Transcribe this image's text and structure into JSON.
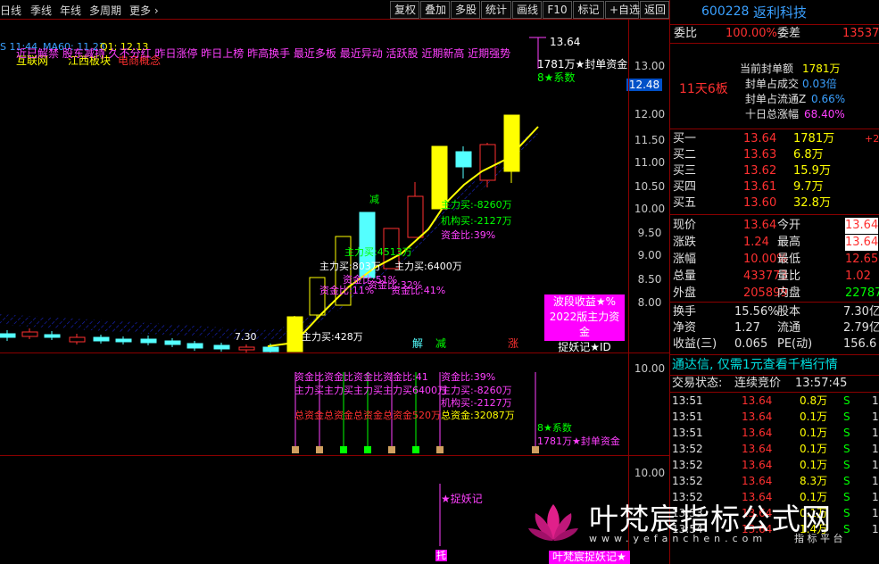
{
  "toolbar": {
    "period_day": "日线",
    "period_season": "季线",
    "period_year": "年线",
    "multi_period": "多周期",
    "more": "更多",
    "buttons": [
      "复权",
      "叠加",
      "多股",
      "统计",
      "画线",
      "F10",
      "标记",
      "+自选",
      "返回"
    ]
  },
  "stock": {
    "code": "600228",
    "name": "返利科技"
  },
  "quote_bar": {
    "time": "S 11:44",
    "ma_label": "MA60: 11.23",
    "q1": "Q1: 12.13"
  },
  "concepts": [
    "互联网",
    "江西板块",
    "电商概念"
  ],
  "tags_line": "近已解禁 股东减持 久不分红 昨日涨停 昨日上榜 昨高换手 最近多板 最近异动 活跃股 近期新高 近期强势",
  "price_axis": [
    "13.00",
    "12.50",
    "12.00",
    "11.50",
    "11.00",
    "10.50",
    "10.00",
    "9.50",
    "9.00",
    "8.50",
    "8.00"
  ],
  "price_axis_current": "12.48",
  "vol_axis": "10.00",
  "ind3_axis": "10.00",
  "chart_labels": {
    "high_price": "13.64",
    "low_price": "7.30",
    "seal_funds": "1781万★封单资金",
    "coef": "8★系数",
    "reduce1": "减",
    "reduce2": "减",
    "explain": "解",
    "up": "涨",
    "main_buy_1": "主力买:428万",
    "main_buy_2": "主力买:803万",
    "main_buy_3": "主力买:6400万",
    "main_buy_4": "主力买:-8260万",
    "inst_buy_4": "机构买:-2127万",
    "fund_ratio_4": "资金比:39%",
    "main_buy_5": "主力买:4513万",
    "fund_ratio_5": "资金比:41%",
    "fund_ratio_6": "资金比:11%",
    "fund_ratio_7": "资金比:51%",
    "fund_ratio_8": "资金比:32%",
    "wave_box_1": "波段收益★%",
    "wave_box_2": "2022版主力资金",
    "wave_box_3": "捉妖记★ID"
  },
  "mid_labels": {
    "fund_ratio": "资金比:39%",
    "main_buy": "主力买:-8260万",
    "inst_buy": "机构买:-2127万",
    "total_funds": "总资金:32087万",
    "coef": "8★系数",
    "seal": "1781万★封单资金",
    "overlap_1": "资金比资金比资金比资金比:41",
    "overlap_2": "主力买主力买主力买主力买6400万",
    "overlap_3": "总资金总资金总资金总资金520万"
  },
  "bottom_labels": {
    "catch": "★捉妖记",
    "tuo": "托"
  },
  "panel": {
    "ratio_label": "委比",
    "ratio_value": "100.00%",
    "diff_label": "委差",
    "diff_value": "13537",
    "board_title": "11天6板",
    "seal_amount_label": "当前封单额",
    "seal_amount_value": "1781万",
    "seal_turn_label": "封单占成交",
    "seal_turn_value": "0.03倍",
    "seal_float_label": "封单占流通Z",
    "seal_float_value": "0.66%",
    "ten_day_label": "十日总涨幅",
    "ten_day_value": "68.40%",
    "bids": [
      {
        "label": "买一",
        "price": "13.64",
        "vol": "1781万",
        "chg": "+2"
      },
      {
        "label": "买二",
        "price": "13.63",
        "vol": "6.8万",
        "chg": ""
      },
      {
        "label": "买三",
        "price": "13.62",
        "vol": "15.9万",
        "chg": ""
      },
      {
        "label": "买四",
        "price": "13.61",
        "vol": "9.7万",
        "chg": ""
      },
      {
        "label": "买五",
        "price": "13.60",
        "vol": "32.8万",
        "chg": ""
      }
    ],
    "stats": [
      {
        "l1": "现价",
        "v1": "13.64",
        "l2": "今开",
        "v2": "13.64"
      },
      {
        "l1": "涨跌",
        "v1": "1.24",
        "l2": "最高",
        "v2": "13.64"
      },
      {
        "l1": "涨幅",
        "v1": "10.00%",
        "l2": "最低",
        "v2": "12.65"
      },
      {
        "l1": "总量",
        "v1": "433773",
        "l2": "量比",
        "v2": "1.02"
      },
      {
        "l1": "外盘",
        "v1": "205899",
        "l2": "内盘",
        "v2": "227874"
      }
    ],
    "stats2": [
      {
        "l1": "换手",
        "v1": "15.56%",
        "l2": "股本",
        "v2": "7.30亿"
      },
      {
        "l1": "净资",
        "v1": "1.27",
        "l2": "流通",
        "v2": "2.79亿"
      },
      {
        "l1": "收益(三)",
        "v1": "0.065",
        "l2": "PE(动)",
        "v2": "156.6"
      }
    ],
    "promo": "通达信, 仅需1元查看千档行情",
    "trade_state_label": "交易状态:",
    "trade_state_value": "连续竞价",
    "trade_time": "13:57:45",
    "ticks": [
      {
        "t": "13:51",
        "p": "13.64",
        "v": "0.8万",
        "s": "S",
        "n": "1"
      },
      {
        "t": "13:51",
        "p": "13.64",
        "v": "0.1万",
        "s": "S",
        "n": "1"
      },
      {
        "t": "13:51",
        "p": "13.64",
        "v": "0.1万",
        "s": "S",
        "n": "1"
      },
      {
        "t": "13:52",
        "p": "13.64",
        "v": "0.1万",
        "s": "S",
        "n": "1"
      },
      {
        "t": "13:52",
        "p": "13.64",
        "v": "0.1万",
        "s": "S",
        "n": "1"
      },
      {
        "t": "13:52",
        "p": "13.64",
        "v": "8.3万",
        "s": "S",
        "n": "1"
      },
      {
        "t": "13:52",
        "p": "13.64",
        "v": "0.1万",
        "s": "S",
        "n": "1"
      },
      {
        "t": "13:53",
        "p": "13.64",
        "v": "0.1万",
        "s": "S",
        "n": "1"
      },
      {
        "t": "13:54",
        "p": "13.64",
        "v": "1.4万",
        "s": "S",
        "n": "1"
      }
    ]
  },
  "watermark": {
    "title": "叶梵宸指标公式网",
    "url": "www.yefanchen.com",
    "extra": "指 标 平 台",
    "foot": "叶梵宸捉妖记★"
  },
  "colors": {
    "up": "#ff3030",
    "down": "#54ffff",
    "ma": "#ffff00",
    "panel_red": "#ff3030"
  }
}
